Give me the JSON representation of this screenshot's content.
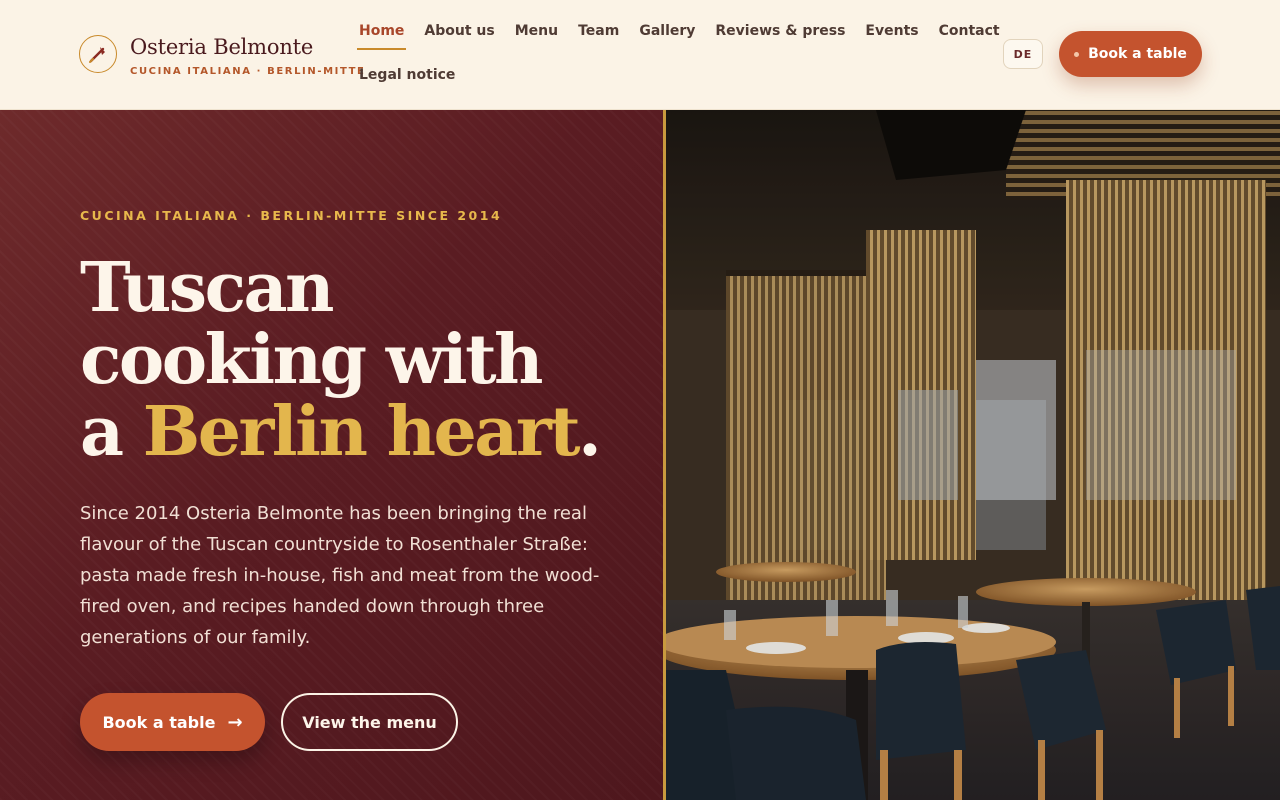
{
  "brand": {
    "name": "Osteria Belmonte",
    "tagline": "CUCINA ITALIANA · BERLIN-MITTE",
    "logo_icon": "fork-quill-icon"
  },
  "nav": {
    "items": [
      {
        "label": "Home",
        "active": true
      },
      {
        "label": "About us"
      },
      {
        "label": "Menu"
      },
      {
        "label": "Team"
      },
      {
        "label": "Gallery"
      },
      {
        "label": "Reviews & press"
      },
      {
        "label": "Events"
      },
      {
        "label": "Contact"
      }
    ],
    "secondary": "Legal notice"
  },
  "header": {
    "lang_label": "DE",
    "book_label": "Book a table"
  },
  "hero": {
    "eyebrow": "CUCINA ITALIANA · BERLIN-MITTE SINCE 2014",
    "headline_line1": "Tuscan",
    "headline_line2": "cooking with",
    "headline_line3_prefix": "a ",
    "headline_accent": "Berlin heart",
    "headline_end": ".",
    "lead": "Since 2014 Osteria Belmonte has been bringing the real flavour of the Tuscan countryside to Rosenthaler Straße: pasta made fresh in-house, fish and meat from the wood-fired oven, and recipes handed down through three generations of our family.",
    "cta_primary": "Book a table",
    "cta_primary_icon": "arrow-right-icon",
    "cta_secondary": "View the menu"
  },
  "colors": {
    "accent": "#c4532e",
    "gold": "#e3b64d",
    "burgundy": "#5a1c22",
    "cream": "#fbf3e6"
  }
}
